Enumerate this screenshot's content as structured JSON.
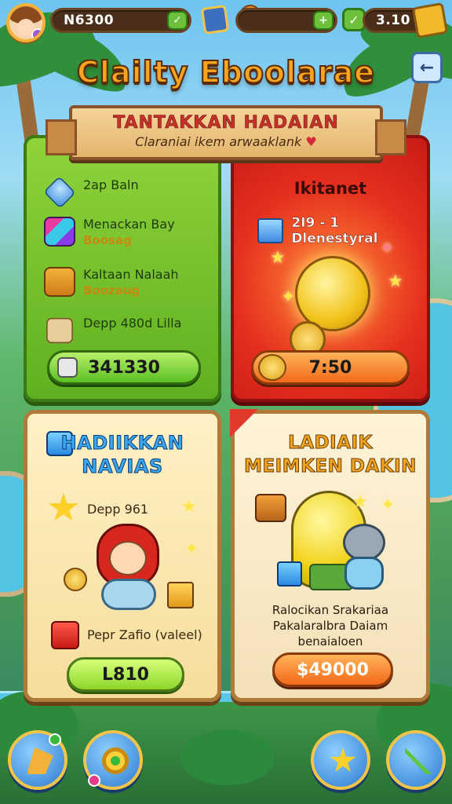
{
  "top_bar": {
    "currency_1": "N6300",
    "currency_1_icon": "leaf-check-icon",
    "currency_2_icon": "plus-icon",
    "currency_3": "3.10"
  },
  "title": "Clailty Eboolarae",
  "banner": {
    "title": "TANTAKKAN HADAIAN",
    "subtitle": "Claraniai ikem arwaaklank"
  },
  "card_green": {
    "rows": [
      {
        "label": "2ap Baln",
        "sub": ""
      },
      {
        "label": "Menackan Bay",
        "sub": "Boosag"
      },
      {
        "label": "Kaltaan Nalaah",
        "sub": "Boozaug"
      },
      {
        "label": "Depp 480d Lilla",
        "sub": ""
      }
    ],
    "button_label": "341330"
  },
  "card_red": {
    "title": "Ikitanet",
    "row_label": "2I9 - 1 Dlenestyral",
    "button_label": "7:50"
  },
  "card_cream_left": {
    "heading_line1": "HADIIKKAN",
    "heading_line2": "NAVIAS",
    "sub_label": "Depp 961",
    "bottom_label": "Pepr Zafio (valeel)",
    "button_label": "L810"
  },
  "card_cream_right": {
    "heading_line1": "LADIAIK",
    "heading_line2": "MEIMKEN DAKIN",
    "text_line1": "Ralocikan Srakariaa",
    "text_line2": "Pakalaralbra Daiam",
    "text_line3": "benaialoen",
    "button_label": "$49000"
  },
  "colors": {
    "green_card": "#6cbf26",
    "red_card": "#e6301e",
    "cream_card": "#fbe9b8",
    "title_orange": "#f7a51e"
  },
  "bottom_nav": [
    "wand-icon",
    "ring-icon",
    "star-icon",
    "arrow-icon"
  ]
}
